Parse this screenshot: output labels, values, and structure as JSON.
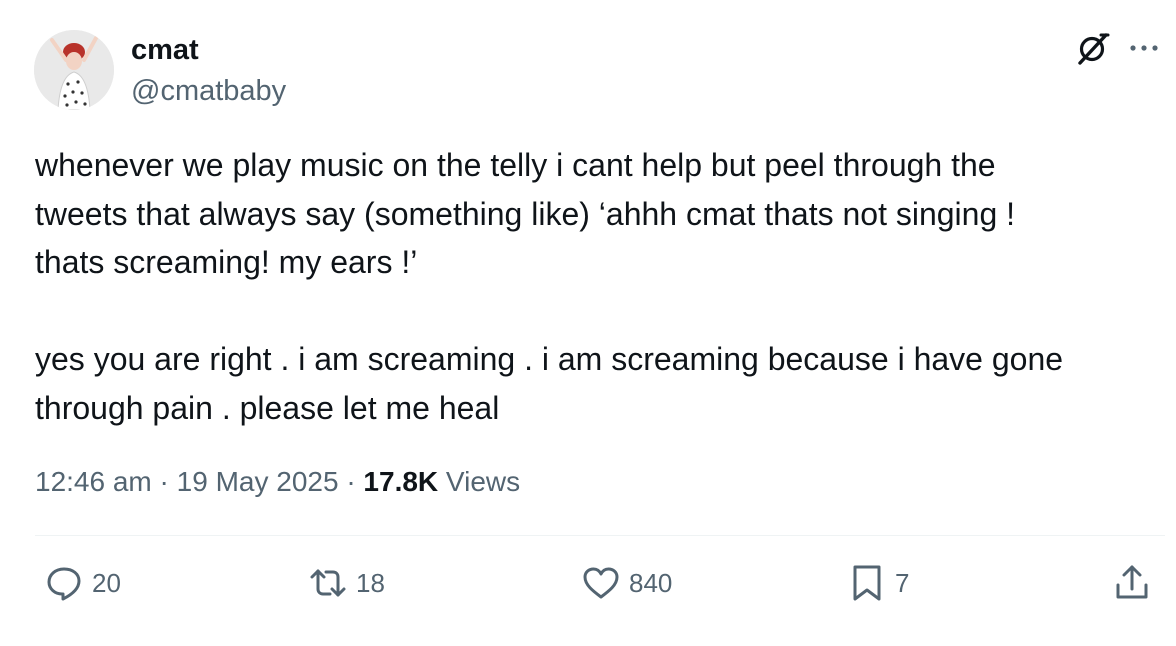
{
  "author": {
    "name": "cmat",
    "handle": "@cmatbaby"
  },
  "tweet": {
    "paragraphs": [
      "whenever we play music on the telly i cant help but peel through the\ntweets that always say (something like) ‘ahhh cmat thats not singing !\nthats screaming! my ears !’",
      "yes you are right . i am screaming . i am screaming because i have gone\nthrough pain . please let me heal"
    ],
    "time": "12:46 am",
    "separator": "·",
    "date": "19 May 2025",
    "views_count": "17.8K",
    "views_label": "Views"
  },
  "actions": {
    "replies": "20",
    "reposts": "18",
    "likes": "840",
    "bookmarks": "7"
  },
  "icons": {
    "grok": "grok-icon",
    "more": "more-icon",
    "reply": "reply-icon",
    "repost": "repost-icon",
    "like": "heart-icon",
    "bookmark": "bookmark-icon",
    "share": "share-icon"
  },
  "colors": {
    "text_primary": "#0f1419",
    "text_secondary": "#536471",
    "divider": "#eff3f4"
  }
}
